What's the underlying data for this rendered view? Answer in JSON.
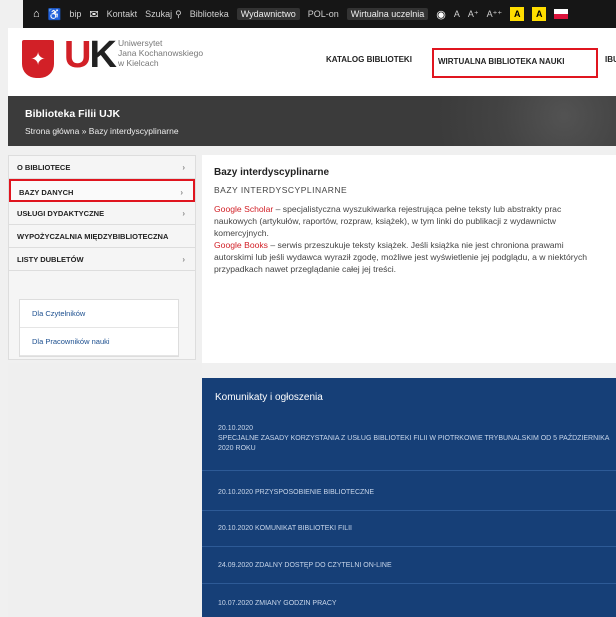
{
  "topbar": {
    "home_icon": "home-icon",
    "bip": "bip",
    "kontakt": "Kontakt",
    "szukaj": "Szukaj",
    "biblioteka": "Biblioteka",
    "wydawnictwo": "Wydawnictwo",
    "polon": "POL-on",
    "wirtualna": "Wirtualna uczelnia",
    "font_a": "A",
    "font_a_plus": "A⁺",
    "font_a_plus2": "A⁺⁺",
    "contrast_a1": "A",
    "contrast_a2": "A"
  },
  "header": {
    "logo_line1": "Uniwersytet",
    "logo_line2": "Jana Kochanowskiego",
    "logo_line3": "w Kielcach",
    "logo_mark": "UJK",
    "nav_katalog": "KATALOG BIBLIOTEKI",
    "nav_wirtualna": "WIRTUALNA BIBLIOTEKA NAUKI",
    "nav_ibuk": "IBUK"
  },
  "banner": {
    "title": "Biblioteka Filii UJK",
    "breadcrumb": "Strona główna » Bazy interdyscyplinarne"
  },
  "sidebar": {
    "items": [
      {
        "label": "O BIBLIOTECE"
      },
      {
        "label": "BAZY DANYCH"
      },
      {
        "label": "USŁUGI DYDAKTYCZNE"
      },
      {
        "label": "WYPOŻYCZALNIA MIĘDZYBIBLIOTECZNA"
      },
      {
        "label": "LISTY DUBLETÓW"
      }
    ],
    "links": [
      {
        "label": "Dla Czytelników"
      },
      {
        "label": "Dla Pracowników nauki"
      }
    ]
  },
  "main": {
    "title": "Bazy interdyscyplinarne",
    "subtitle": "BAZY INTERDYSCYPLINARNE",
    "scholar_name": "Google Scholar",
    "scholar_desc": " – specjalistyczna wyszukiwarka rejestrująca pełne teksty lub abstrakty prac naukowych (artykułów, raportów, rozpraw, książek), w tym linki do publikacji z wydawnictw komercyjnych.",
    "books_name": "Google Books",
    "books_desc": " – serwis przeszukuje teksty książek. Jeśli książka nie jest chroniona prawami autorskimi lub jeśli wydawca wyraził zgodę, możliwe jest wyświetlenie jej podglądu, a w niektórych przypadkach nawet przeglądanie całej jej treści."
  },
  "news": {
    "title": "Komunikaty i ogłoszenia",
    "items": [
      {
        "date": "20.10.2020",
        "text": "SPECJALNE ZASADY KORZYSTANIA Z USŁUG BIBLIOTEKI FILII W PIOTRKOWIE TRYBUNALSKIM OD 5 PAŹDZIERNIKA 2020 ROKU"
      },
      {
        "date": "20.10.2020",
        "text": "PRZYSPOSOBIENIE BIBLIOTECZNE"
      },
      {
        "date": "20.10.2020",
        "text": "KOMUNIKAT BIBLIOTEKI FILII"
      },
      {
        "date": "24.09.2020",
        "text": "ZDALNY DOSTĘP DO CZYTELNI ON-LINE"
      },
      {
        "date": "10.07.2020",
        "text": "ZMIANY GODZIN PRACY"
      }
    ]
  },
  "colors": {
    "accent_red": "#d22027",
    "highlight_red": "#e0151f",
    "news_blue": "#163f77",
    "banner_gray": "#3b3b3b"
  }
}
